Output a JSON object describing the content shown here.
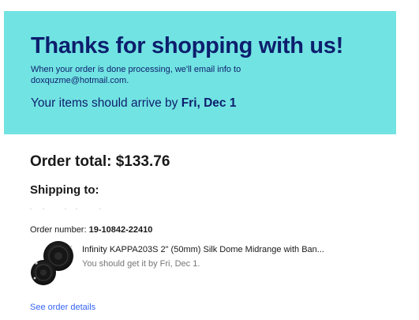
{
  "hero": {
    "title": "Thanks for shopping with us!",
    "message_line1": "When your order is done processing, we'll email info to",
    "message_line2": "doxquzme@hotmail.com.",
    "arrive_prefix": "Your items should arrive by ",
    "arrive_date": "Fri, Dec 1",
    "background_color": "#71e3e2",
    "text_color": "#0d1e6d"
  },
  "summary": {
    "order_total": "Order total: $133.76",
    "shipping_heading": "Shipping to:",
    "order_number_label": "Order number: ",
    "order_number": "19-10842-22410"
  },
  "item": {
    "image_icon": "speaker-pair-image",
    "title": "Infinity KAPPA203S 2\" (50mm) Silk Dome Midrange with Ban...",
    "eta": "You should get it by Fri, Dec 1."
  },
  "links": {
    "see_order_details": "See order details",
    "link_color": "#3665f3"
  }
}
